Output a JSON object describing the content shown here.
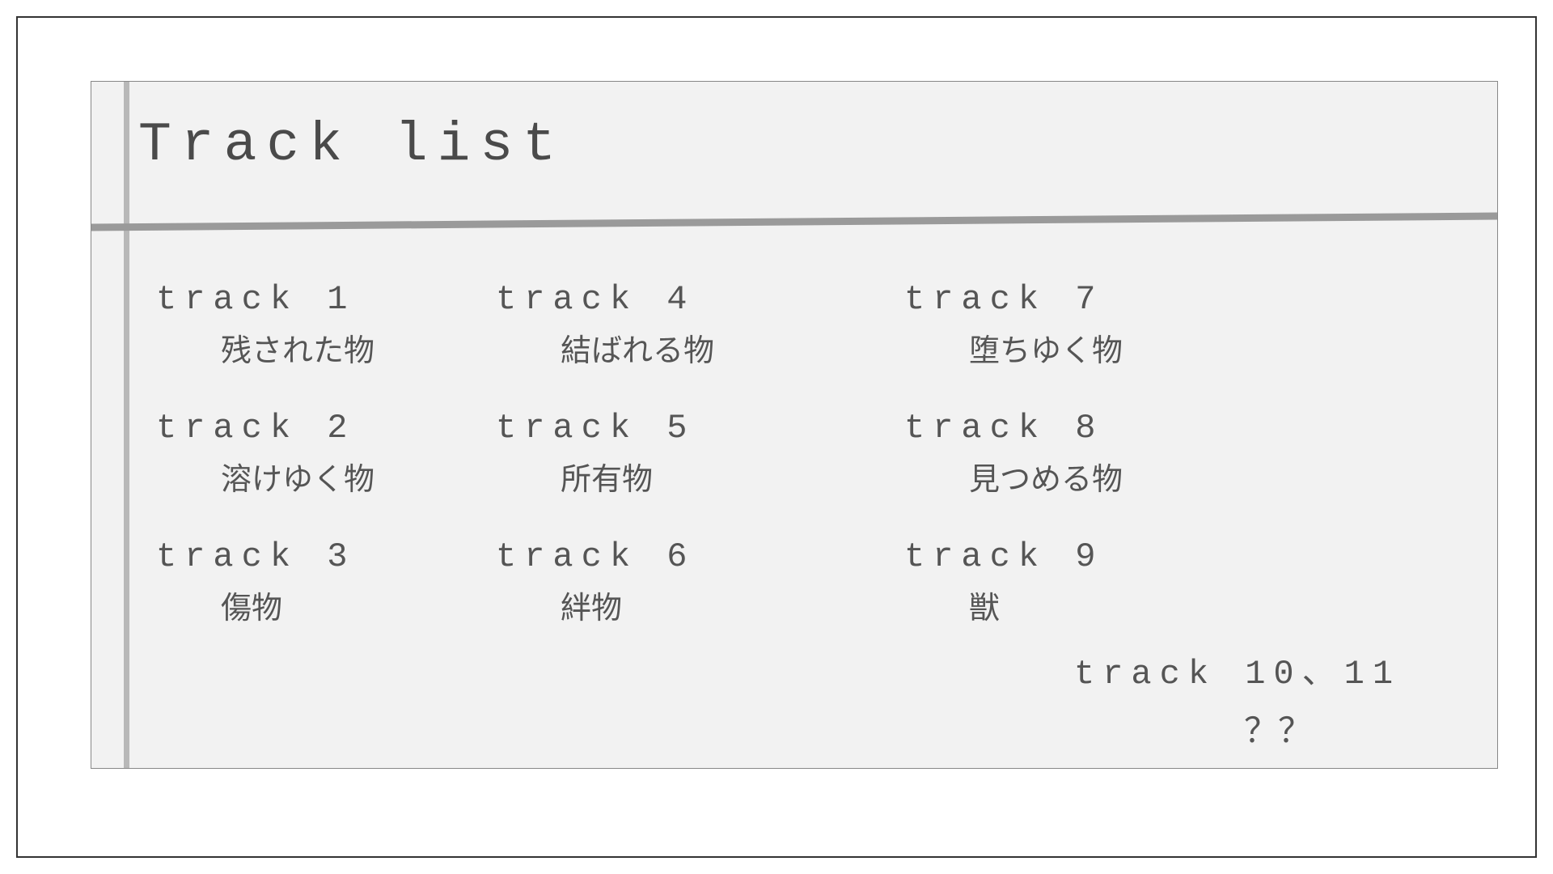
{
  "title": "Track list",
  "columns": [
    [
      {
        "label": "track 1",
        "name": "残された物"
      },
      {
        "label": "track 2",
        "name": "溶けゆく物"
      },
      {
        "label": "track  3",
        "name": "傷物"
      }
    ],
    [
      {
        "label": "track 4",
        "name": "結ばれる物"
      },
      {
        "label": "track 5",
        "name": "所有物"
      },
      {
        "label": "track 6",
        "name": "絆物"
      }
    ],
    [
      {
        "label": "track 7",
        "name": "堕ちゆく物"
      },
      {
        "label": "track 8",
        "name": "見つめる物"
      },
      {
        "label": "track 9",
        "name": "獣"
      }
    ]
  ],
  "extra": {
    "label": "track 10、11",
    "name": "？？"
  }
}
